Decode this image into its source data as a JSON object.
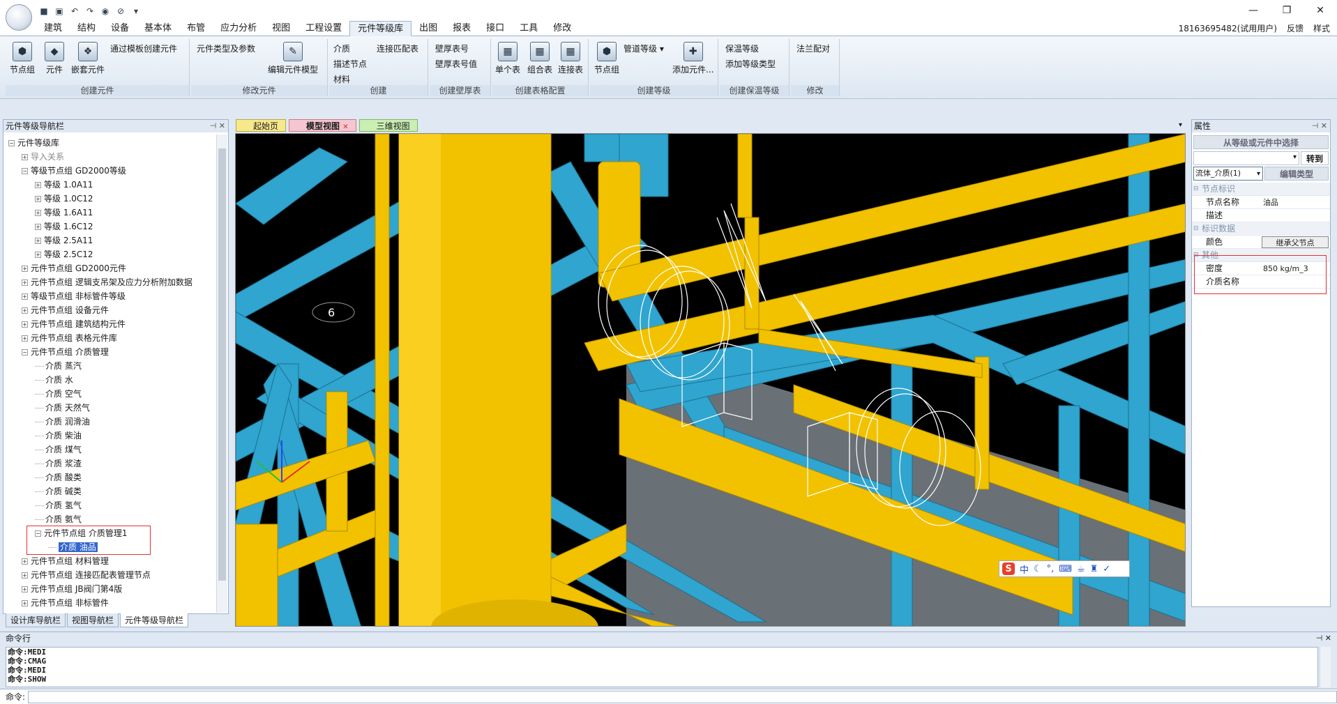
{
  "menu": [
    "建筑",
    "结构",
    "设备",
    "基本体",
    "布管",
    "应力分析",
    "视图",
    "工程设置",
    "元件等级库",
    "出图",
    "报表",
    "接口",
    "工具",
    "修改"
  ],
  "user": {
    "account": "18163695482",
    "status": "(试用用户)",
    "feedback": "反馈",
    "style": "样式"
  },
  "ribbon": {
    "g1": {
      "label": "创建元件",
      "node_group": "节点组",
      "element": "元件",
      "nested": "嵌套元件",
      "template": "通过模板创建元件"
    },
    "g2": {
      "label": "修改元件",
      "types": "元件类型及参数",
      "edit_model": "编辑元件模型"
    },
    "g3": {
      "label": "创建",
      "medium": "介质",
      "connect_table": "连接匹配表",
      "desc_node": "描述节点",
      "material": "材料"
    },
    "g4": {
      "label": "创建壁厚表",
      "wall_table": "壁厚表号",
      "wall_value": "壁厚表号值"
    },
    "g5": {
      "label": "创建表格配置",
      "single": "单个表",
      "combined": "组合表",
      "connection": "连接表"
    },
    "g6": {
      "label": "创建等级",
      "node_group": "节点组",
      "pipe_grade": "管道等级",
      "add_element": "添加元件..."
    },
    "g7": {
      "label": "创建保温等级",
      "insul_grade": "保温等级",
      "add_grade_type": "添加等级类型"
    },
    "g8": {
      "label": "修改",
      "flange": "法兰配对"
    }
  },
  "left_panel": {
    "title": "元件等级导航栏"
  },
  "tree": [
    {
      "d": 0,
      "t": "元件等级库",
      "ex": "−"
    },
    {
      "d": 1,
      "t": "导入关系",
      "ex": "+",
      "muted": true
    },
    {
      "d": 1,
      "t": "等级节点组 GD2000等级",
      "ex": "−"
    },
    {
      "d": 2,
      "t": "等级 1.0A11",
      "ex": "+"
    },
    {
      "d": 2,
      "t": "等级 1.0C12",
      "ex": "+"
    },
    {
      "d": 2,
      "t": "等级 1.6A11",
      "ex": "+"
    },
    {
      "d": 2,
      "t": "等级 1.6C12",
      "ex": "+"
    },
    {
      "d": 2,
      "t": "等级 2.5A11",
      "ex": "+"
    },
    {
      "d": 2,
      "t": "等级 2.5C12",
      "ex": "+"
    },
    {
      "d": 1,
      "t": "元件节点组 GD2000元件",
      "ex": "+"
    },
    {
      "d": 1,
      "t": "元件节点组 逻辑支吊架及应力分析附加数据",
      "ex": "+"
    },
    {
      "d": 1,
      "t": "等级节点组 非标管件等级",
      "ex": "+"
    },
    {
      "d": 1,
      "t": "元件节点组 设备元件",
      "ex": "+"
    },
    {
      "d": 1,
      "t": "元件节点组 建筑结构元件",
      "ex": "+"
    },
    {
      "d": 1,
      "t": "元件节点组 表格元件库",
      "ex": "+"
    },
    {
      "d": 1,
      "t": "元件节点组 介质管理",
      "ex": "−"
    },
    {
      "d": 2,
      "t": "介质 蒸汽",
      "ex": ""
    },
    {
      "d": 2,
      "t": "介质 水",
      "ex": ""
    },
    {
      "d": 2,
      "t": "介质 空气",
      "ex": ""
    },
    {
      "d": 2,
      "t": "介质 天然气",
      "ex": ""
    },
    {
      "d": 2,
      "t": "介质 润滑油",
      "ex": ""
    },
    {
      "d": 2,
      "t": "介质 柴油",
      "ex": ""
    },
    {
      "d": 2,
      "t": "介质 煤气",
      "ex": ""
    },
    {
      "d": 2,
      "t": "介质 浆渣",
      "ex": ""
    },
    {
      "d": 2,
      "t": "介质 酸类",
      "ex": ""
    },
    {
      "d": 2,
      "t": "介质 碱类",
      "ex": ""
    },
    {
      "d": 2,
      "t": "介质 氢气",
      "ex": ""
    },
    {
      "d": 2,
      "t": "介质 氨气",
      "ex": ""
    },
    {
      "d": 2,
      "t": "元件节点组 介质管理1",
      "ex": "−"
    },
    {
      "d": 3,
      "t": "介质 油品",
      "ex": "",
      "sel": true
    },
    {
      "d": 1,
      "t": "元件节点组 材料管理",
      "ex": "+"
    },
    {
      "d": 1,
      "t": "元件节点组 连接匹配表管理节点",
      "ex": "+"
    },
    {
      "d": 1,
      "t": "元件节点组 JB阀门第4版",
      "ex": "+"
    },
    {
      "d": 1,
      "t": "元件节点组 非标管件",
      "ex": "+"
    }
  ],
  "bottom_tabs": [
    "设计库导航栏",
    "视图导航栏",
    "元件等级导航栏"
  ],
  "doc_tabs": [
    "起始页",
    "模型视图",
    "三维视图"
  ],
  "props": {
    "title": "属性",
    "select_btn": "从等级或元件中选择",
    "goto": "转到",
    "type_sel": "流体_介质(1)",
    "edit_type": "编辑类型",
    "cat1": "节点标识",
    "node_name_k": "节点名称",
    "node_name_v": "油品",
    "desc_k": "描述",
    "cat2": "标识数据",
    "color_k": "颜色",
    "color_v": "继承父节点",
    "cat3": "其他",
    "density_k": "密度",
    "density_v": "850 kg/m_3",
    "medium_name_k": "介质名称"
  },
  "cmd": {
    "title": "命令行",
    "log": [
      "命令:MEDI",
      "命令:CMAG",
      "命令:MEDI",
      "命令:SHOW"
    ],
    "prompt": "命令:"
  },
  "ime": {
    "logo": "S",
    "mode": "中"
  },
  "viewport": {
    "label": "6"
  }
}
